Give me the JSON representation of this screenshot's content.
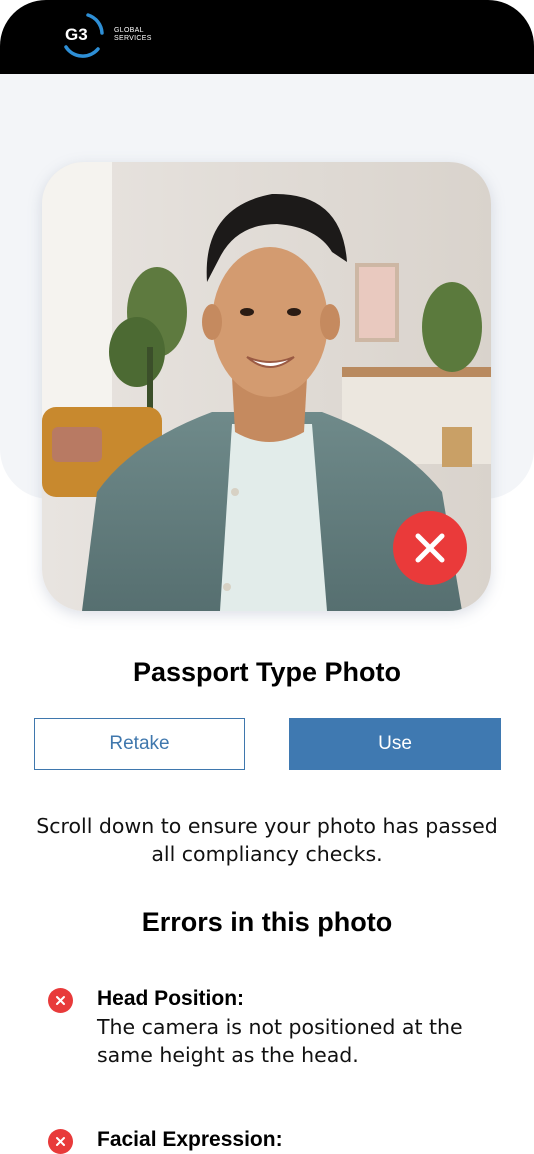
{
  "header": {
    "logo_mark": "G3",
    "logo_line1": "GLOBAL",
    "logo_line2": "SERVICES"
  },
  "photo": {
    "status": "rejected",
    "status_icon": "close-icon",
    "status_color": "#ea3a3a"
  },
  "title": "Passport Type Photo",
  "actions": {
    "retake_label": "Retake",
    "use_label": "Use"
  },
  "instructions": "Scroll down to ensure your photo has passed all compliancy checks.",
  "errors_heading": "Errors in this photo",
  "errors": [
    {
      "title": "Head Position:",
      "description": "The camera is not positioned at the same height as the head."
    },
    {
      "title": "Facial Expression:",
      "description": ""
    }
  ],
  "colors": {
    "accent": "#3f79b1",
    "error": "#e83a3a",
    "header": "#000000"
  }
}
